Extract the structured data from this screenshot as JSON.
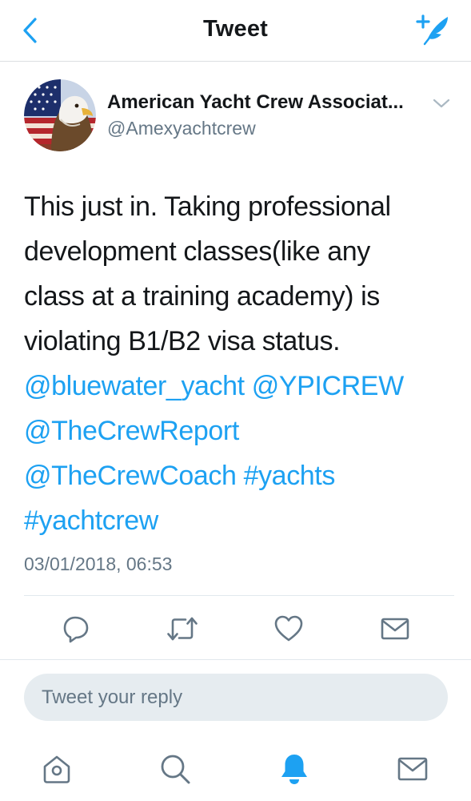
{
  "colors": {
    "accent": "#1da1f2",
    "text": "#14171a",
    "muted": "#657786",
    "icon": "#657786",
    "divider": "#e1e8ed",
    "reply_bg": "#e6ecf0"
  },
  "header": {
    "back_icon": "chevron-left-icon",
    "title": "Tweet",
    "compose_icon": "compose-tweet-icon"
  },
  "author": {
    "name": "American Yacht Crew Associat...",
    "handle": "@Amexyachtcrew",
    "avatar_icon": "eagle-flag-avatar",
    "more_icon": "chevron-down-icon"
  },
  "tweet": {
    "text_lines": [
      "This just in. Taking professional",
      "development classes(like any",
      "class at a training academy) is",
      "violating B1/B2 visa status."
    ],
    "mentions": {
      "bluewater": "@bluewater_yacht",
      "ypicrew": "@YPICREW",
      "crewreport": "@TheCrewReport",
      "crewcoach": "@TheCrewCoach"
    },
    "hashtags": {
      "yachts": "#yachts",
      "yachtcrew": "#yachtcrew"
    },
    "timestamp": "03/01/2018, 06:53"
  },
  "actions": [
    {
      "name": "reply",
      "icon": "reply-icon"
    },
    {
      "name": "retweet",
      "icon": "retweet-icon"
    },
    {
      "name": "like",
      "icon": "heart-icon"
    },
    {
      "name": "share",
      "icon": "envelope-icon"
    }
  ],
  "reply": {
    "placeholder": "Tweet your reply"
  },
  "tabbar": [
    {
      "name": "home",
      "icon": "home-icon",
      "active": false
    },
    {
      "name": "search",
      "icon": "search-icon",
      "active": false
    },
    {
      "name": "notifications",
      "icon": "bell-icon",
      "active": true
    },
    {
      "name": "messages",
      "icon": "envelope-icon",
      "active": false
    }
  ]
}
